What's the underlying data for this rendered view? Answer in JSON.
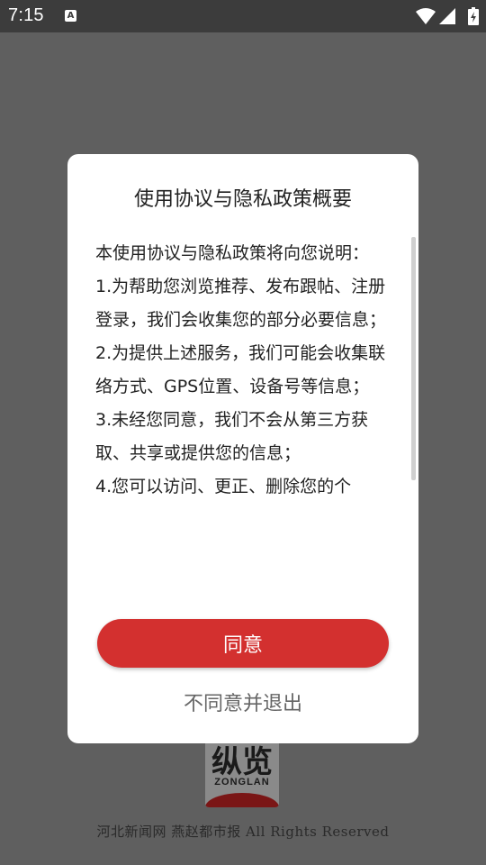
{
  "status_bar": {
    "time": "7:15",
    "app_icon_glyph": "A",
    "icons": [
      "wifi-icon",
      "signal-icon",
      "battery-icon"
    ]
  },
  "background": {
    "logo_main": "纵览",
    "logo_sub": "ZONGLAN",
    "footer": "河北新闻网  燕赵都市报  All  Rights  Reserved"
  },
  "dialog": {
    "title": "使用协议与隐私政策概要",
    "paragraphs": [
      "本使用协议与隐私政策将向您说明：",
      "1.为帮助您浏览推荐、发布跟帖、注册登录，我们会收集您的部分必要信息；",
      "2.为提供上述服务，我们可能会收集联络方式、GPS位置、设备号等信息；",
      "3.未经您同意，我们不会从第三方获取、共享或提供您的信息；",
      "4.您可以访问、更正、删除您的个"
    ],
    "agree_label": "同意",
    "disagree_label": "不同意并退出"
  },
  "colors": {
    "accent": "#d3302f",
    "scrim": "#5f5f5f",
    "status_bar": "#3c3c3c"
  }
}
